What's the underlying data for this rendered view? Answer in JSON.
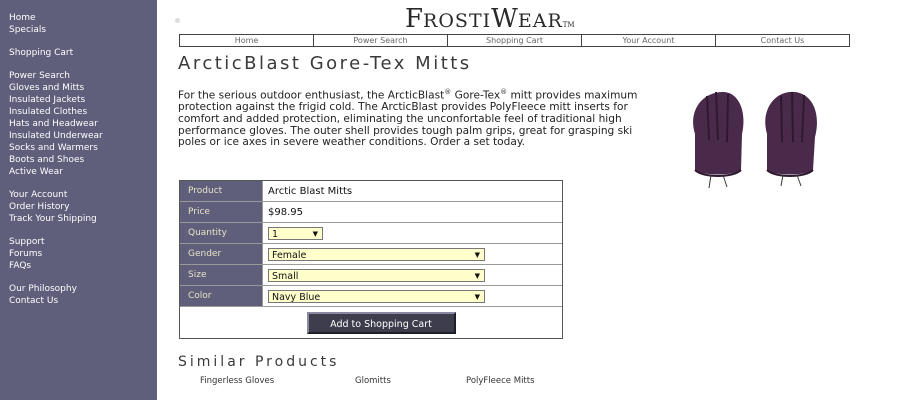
{
  "sidebar": {
    "groups": [
      [
        "Home",
        "Specials"
      ],
      [
        "Shopping Cart"
      ],
      [
        "Power Search",
        "Gloves and Mitts",
        "Insulated Jackets",
        "Insulated Clothes",
        "Hats and Headwear",
        "Insulated Underwear",
        "Socks and Warmers",
        "Boots and Shoes",
        "Active Wear"
      ],
      [
        "Your Account",
        "Order History",
        "Track Your Shipping"
      ],
      [
        "Support",
        "Forums",
        "FAQs"
      ],
      [
        "Our Philosophy",
        "Contact Us"
      ]
    ]
  },
  "logo": {
    "f": "F",
    "rosti": "ROSTI",
    "w": "W",
    "ear": "EAR",
    "tm": "TM"
  },
  "topnav": [
    "Home",
    "Power Search",
    "Shopping Cart",
    "Your Account",
    "Contact Us"
  ],
  "product": {
    "title": "ArcticBlast Gore-Tex Mitts",
    "desc_a": "For the serious outdoor enthusiast, the ",
    "brand": "ArcticBlast",
    "reg1": "®",
    "desc_b": " Gore-Tex",
    "reg2": "®",
    "desc_c": " mitt provides maximum protection against the frigid cold. The ArcticBlast provides PolyFleece mitt inserts for comfort and added protection, eliminating the unconfortable feel of traditional high performance gloves. The outer shell provides tough palm grips, great for grasping ski poles or ice axes in severe weather conditions. Order a set today."
  },
  "order": {
    "product_label": "Product",
    "product_value": "Arctic Blast Mitts",
    "price_label": "Price",
    "price_value": "$98.95",
    "quantity_label": "Quantity",
    "quantity_value": "1",
    "gender_label": "Gender",
    "gender_value": "Female",
    "size_label": "Size",
    "size_value": "Small",
    "color_label": "Color",
    "color_value": "Navy Blue",
    "add_button": "Add to Shopping Cart"
  },
  "similar": {
    "title": "Similar Products",
    "items": [
      "Fingerless Gloves",
      "Glomitts",
      "PolyFleece Mitts"
    ]
  },
  "colors": {
    "sidebar": "#5f5e7b",
    "label_text": "#e8e4c8",
    "select_bg": "#ffffcc",
    "mitt": "#4a2a4a",
    "button": "#3e3d4e"
  }
}
